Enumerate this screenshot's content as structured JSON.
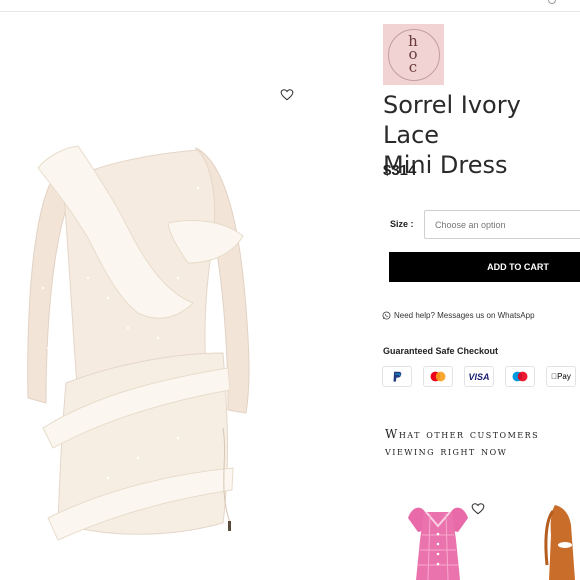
{
  "product": {
    "title_line1": "Sorrel Ivory Lace",
    "title_line2": "Mini Dress",
    "price": "$314"
  },
  "brand": {
    "logo_text": "hoc"
  },
  "options": {
    "size_label": "Size :",
    "size_placeholder": "Choose an option"
  },
  "actions": {
    "add_to_cart": "ADD TO CART"
  },
  "help": {
    "text": "Need help? Messages us on WhatsApp"
  },
  "checkout": {
    "title": "Guaranteed Safe Checkout",
    "methods": [
      "paypal-icon",
      "mastercard-icon",
      "visa-icon",
      "maestro-icon",
      "apple-pay-icon"
    ],
    "visa_label": "VISA",
    "applepay_label": "Pay"
  },
  "related": {
    "heading_line1": "What other customers",
    "heading_line2": "viewing right now"
  },
  "colors": {
    "brand_pink": "#f1d3d4",
    "button_black": "#000000",
    "dress_ivory": "#f6efe6",
    "thumb_pink": "#e86aa8",
    "thumb_orange": "#c96d2a"
  }
}
